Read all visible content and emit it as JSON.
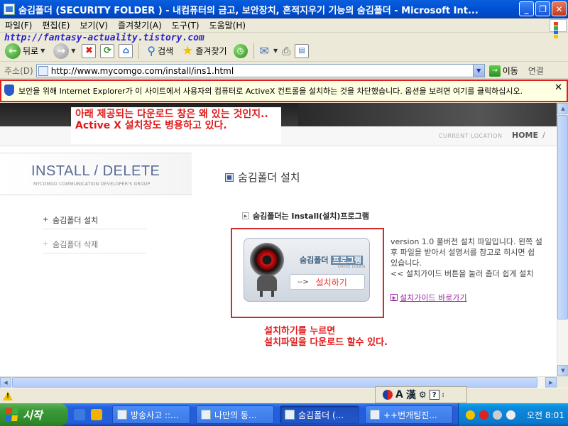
{
  "window": {
    "title": "숨김폴더 (SECURITY FOLDER ) - 내컴퓨터의 금고, 보안장치, 흔적지우기 기능의 숨김폴더 - Microsoft Int...",
    "buttons": {
      "minimize": "_",
      "maximize": "❐",
      "close": "✕"
    }
  },
  "menu": [
    "파일(F)",
    "편집(E)",
    "보기(V)",
    "즐겨찾기(A)",
    "도구(T)",
    "도움말(H)"
  ],
  "watermark": "http://fantasy-actuality.tistory.com",
  "toolbar": {
    "back_label": "뒤로",
    "search_label": "검색",
    "favorites_label": "즐겨찾기"
  },
  "address": {
    "label": "주소(D)",
    "url": "http://www.mycomgo.com/install/ins1.html",
    "go_label": "이동",
    "links_label": "연결"
  },
  "infobar": {
    "message": "보안을 위해 Internet Explorer가 이 사이트에서 사용자의 컴퓨터로 ActiveX 컨트롤을 설치하는 것을 차단했습니다. 옵션을 보려면 여기를 클릭하십시오.",
    "close": "✕"
  },
  "page": {
    "current_location": "CURRENT LOCATION",
    "home": "HOME",
    "crumb_sep": "/",
    "side_title": "INSTALL / DELETE",
    "side_subtitle": "MYCOMGO COMMUNICATION DEVELOPER'S GROUP",
    "side_items": [
      {
        "label": "숨김폴더 설치",
        "bullet": "+"
      },
      {
        "label": "숨김폴더 삭제",
        "bullet": "+"
      }
    ],
    "section_title": "숨김폴더 설치",
    "sub_title": "숨김폴더는 Install(설치)프로그램",
    "card_title_a": "숨김폴더",
    "card_title_b": "프로그램",
    "card_sub": "DRIVE DOWN",
    "card_arrow": "-->",
    "card_button": "설치하기",
    "description": [
      "version 1.0 풀버전 설치 파일입니다. 왼쪽 설",
      "후 파일을 받아서 설명서를 참고로 히시면 쉽",
      "있습니다.",
      "<< 설치가이드 버튼을 눌러 좀더 쉽게 설치"
    ],
    "guide_link": "설치가이드 바로가기"
  },
  "annotations": {
    "top": "아래 제공되는 다운로드 창은 왜 있는 것인지.. Active X 설치창도 병용하고 있다.",
    "bottom_line1": "설치하기를 누르면",
    "bottom_line2": "설치파일을 다운로드 할수 있다."
  },
  "ime": {
    "a": "A",
    "han": "漢"
  },
  "taskbar": {
    "start": "시작",
    "tasks": [
      "방송사고 ::...",
      "나만의 동...",
      "숨김폴더 (...",
      "++번개팅진..."
    ],
    "clock": "오전 8:01"
  },
  "colors": {
    "annotation": "#E01B1B",
    "highlight_box": "#D12B2B",
    "link": "#9A2AA0",
    "side_title": "#596A96"
  }
}
